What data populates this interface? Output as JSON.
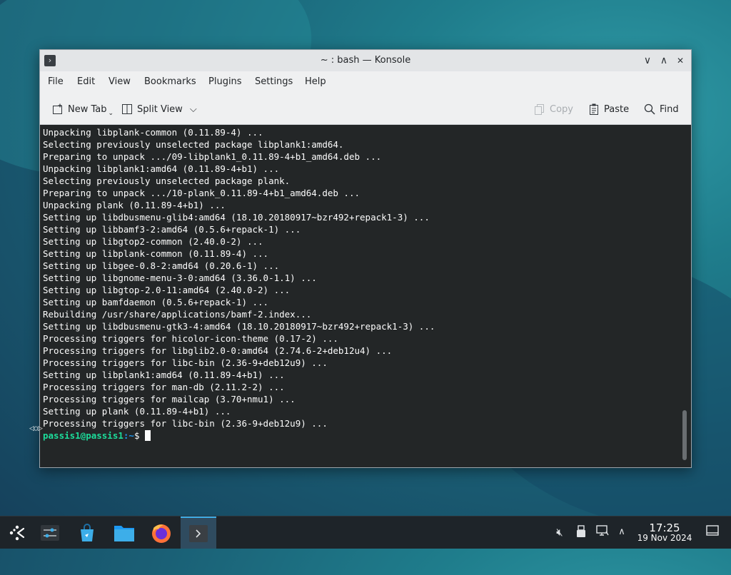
{
  "window": {
    "title": "~ : bash — Konsole",
    "controls": {
      "minimize": "∨",
      "maximize": "∧",
      "close": "✕"
    }
  },
  "menubar": [
    "File",
    "Edit",
    "View",
    "Bookmarks",
    "Plugins",
    "Settings",
    "Help"
  ],
  "toolbar": {
    "new_tab": "New Tab",
    "split_view": "Split View",
    "copy": "Copy",
    "paste": "Paste",
    "find": "Find"
  },
  "terminal": {
    "lines": [
      "Unpacking libplank-common (0.11.89-4) ...",
      "Selecting previously unselected package libplank1:amd64.",
      "Preparing to unpack .../09-libplank1_0.11.89-4+b1_amd64.deb ...",
      "Unpacking libplank1:amd64 (0.11.89-4+b1) ...",
      "Selecting previously unselected package plank.",
      "Preparing to unpack .../10-plank_0.11.89-4+b1_amd64.deb ...",
      "Unpacking plank (0.11.89-4+b1) ...",
      "Setting up libdbusmenu-glib4:amd64 (18.10.20180917~bzr492+repack1-3) ...",
      "Setting up libbamf3-2:amd64 (0.5.6+repack-1) ...",
      "Setting up libgtop2-common (2.40.0-2) ...",
      "Setting up libplank-common (0.11.89-4) ...",
      "Setting up libgee-0.8-2:amd64 (0.20.6-1) ...",
      "Setting up libgnome-menu-3-0:amd64 (3.36.0-1.1) ...",
      "Setting up libgtop-2.0-11:amd64 (2.40.0-2) ...",
      "Setting up bamfdaemon (0.5.6+repack-1) ...",
      "Rebuilding /usr/share/applications/bamf-2.index...",
      "Setting up libdbusmenu-gtk3-4:amd64 (18.10.20180917~bzr492+repack1-3) ...",
      "Processing triggers for hicolor-icon-theme (0.17-2) ...",
      "Processing triggers for libglib2.0-0:amd64 (2.74.6-2+deb12u4) ...",
      "Processing triggers for libc-bin (2.36-9+deb12u9) ...",
      "Setting up libplank1:amd64 (0.11.89-4+b1) ...",
      "Processing triggers for man-db (2.11.2-2) ...",
      "Processing triggers for mailcap (3.70+nmu1) ...",
      "Setting up plank (0.11.89-4+b1) ...",
      "Processing triggers for libc-bin (2.36-9+deb12u9) ..."
    ],
    "prompt_user": "passis1@passis1",
    "prompt_path": ":~",
    "prompt_symbol": "$ "
  },
  "taskbar": {
    "time": "17:25",
    "date": "19 Nov 2024"
  },
  "colors": {
    "terminal_bg": "#232627",
    "prompt_user": "#1cdc9a",
    "prompt_path": "#1d99f3",
    "taskbar_bg": "#1e2429",
    "active_accent": "#3daee9"
  },
  "icons": [
    "terminal-app-icon",
    "new-tab-icon",
    "split-view-icon",
    "copy-icon",
    "paste-icon",
    "find-icon",
    "app-launcher-icon",
    "system-settings-icon",
    "discover-icon",
    "file-manager-icon",
    "firefox-icon",
    "konsole-icon",
    "volume-muted-icon",
    "usb-icon",
    "network-icon",
    "tray-expand-icon",
    "show-desktop-icon"
  ]
}
